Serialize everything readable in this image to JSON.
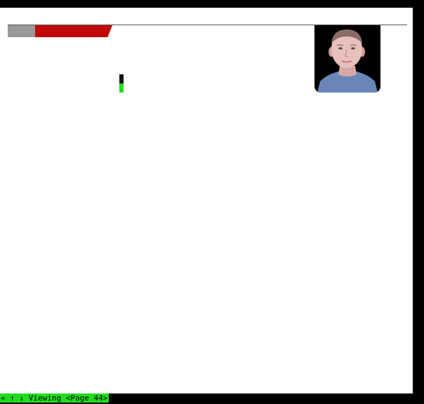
{
  "status_bar": {
    "text": "« ↑ ↓ Viewing <Page 44>"
  },
  "colors": {
    "background": "#000000",
    "page": "#ffffff",
    "tab_gray": "#999999",
    "tab_red": "#c00a0a",
    "status_green": "#1fdc1f",
    "cursor_green": "#22dd22"
  }
}
